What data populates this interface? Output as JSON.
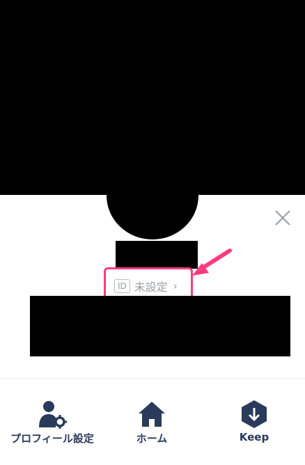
{
  "profile": {
    "id_badge": "ID",
    "id_status": "未設定",
    "id_chevron": "›"
  },
  "tabs": [
    {
      "label": "プロフィール設定",
      "icon": "profile-settings-icon"
    },
    {
      "label": "ホーム",
      "icon": "home-icon"
    },
    {
      "label": "Keep",
      "icon": "keep-download-icon"
    }
  ],
  "colors": {
    "highlight": "#ff3b7f",
    "tab_icon": "#2a3a5b",
    "id_text": "#9a9ea6"
  }
}
